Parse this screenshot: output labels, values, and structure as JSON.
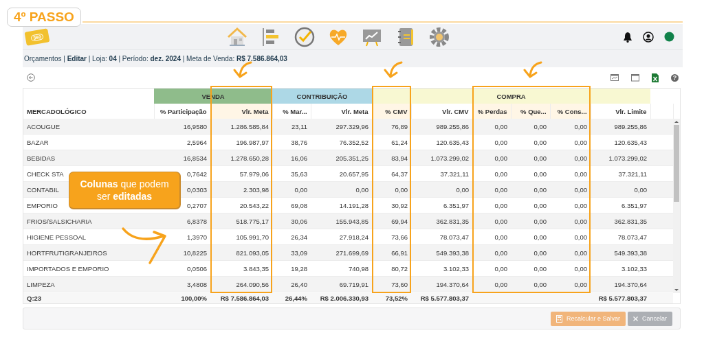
{
  "step_badge": "4º PASSO",
  "header": {
    "logo_text": "360"
  },
  "breadcrumb": "Orçamentos | **Editar** | Loja: **04** | Período: **dez. 2024** | Meta de Venda: **R$ 7.586.864,03**",
  "toolbar": {
    "help_glyph": "?"
  },
  "table": {
    "groups": [
      {
        "label": "MERCADOLÓGICO",
        "kind": "plain"
      },
      {
        "label": "VENDA",
        "kind": "band",
        "color": "#8fbc8b",
        "columns": [
          {
            "label": "% Participação",
            "highlighted": false
          },
          {
            "label": "Vlr. Meta",
            "highlighted": true
          }
        ]
      },
      {
        "label": "CONTRIBUIÇÃO",
        "kind": "band",
        "color": "#add8e6",
        "columns": [
          {
            "label": "% Mar...",
            "highlighted": false
          },
          {
            "label": "Vlr. Meta",
            "highlighted": false
          }
        ]
      },
      {
        "label": "COMPRA",
        "kind": "band",
        "color": "#f8f8d2",
        "columns": [
          {
            "label": "% CMV",
            "highlighted": true
          },
          {
            "label": "Vlr. CMV",
            "highlighted": false
          },
          {
            "label": "% Perdas",
            "highlighted": true
          },
          {
            "label": "% Que...",
            "highlighted": true
          },
          {
            "label": "% Cons...",
            "highlighted": true
          },
          {
            "label": "Vlr. Limite",
            "highlighted": false
          }
        ]
      }
    ],
    "rows": [
      [
        "ACOUGUE",
        "16,9580",
        "1.286.585,84",
        "23,11",
        "297.329,96",
        "76,89",
        "989.255,86",
        "0,00",
        "0,00",
        "0,00",
        "989.255,86"
      ],
      [
        "BAZAR",
        "2,5964",
        "196.987,97",
        "38,76",
        "76.352,52",
        "61,24",
        "120.635,43",
        "0,00",
        "0,00",
        "0,00",
        "120.635,43"
      ],
      [
        "BEBIDAS",
        "16,8534",
        "1.278.650,28",
        "16,06",
        "205.351,25",
        "83,94",
        "1.073.299,02",
        "0,00",
        "0,00",
        "0,00",
        "1.073.299,02"
      ],
      [
        "CHECK STA",
        "0,7642",
        "57.979,06",
        "35,63",
        "20.657,95",
        "64,37",
        "37.321,11",
        "0,00",
        "0,00",
        "0,00",
        "37.321,11"
      ],
      [
        "CONTABIL",
        "0,0303",
        "2.303,98",
        "0,00",
        "0,00",
        "0,00",
        "0,00",
        "0,00",
        "0,00",
        "0,00",
        "0,00"
      ],
      [
        "EMPORIO",
        "0,2707",
        "20.543,22",
        "69,08",
        "14.191,28",
        "30,92",
        "6.351,97",
        "0,00",
        "0,00",
        "0,00",
        "6.351,97"
      ],
      [
        "FRIOS/SALSICHARIA",
        "6,8378",
        "518.775,17",
        "30,06",
        "155.943,85",
        "69,94",
        "362.831,35",
        "0,00",
        "0,00",
        "0,00",
        "362.831,35"
      ],
      [
        "HIGIENE PESSOAL",
        "1,3970",
        "105.991,70",
        "26,34",
        "27.918,24",
        "73,66",
        "78.073,47",
        "0,00",
        "0,00",
        "0,00",
        "78.073,47"
      ],
      [
        "HORTFRUTIGRANJEIROS",
        "10,8225",
        "821.093,05",
        "33,09",
        "271.699,69",
        "66,91",
        "549.393,38",
        "0,00",
        "0,00",
        "0,00",
        "549.393,38"
      ],
      [
        "IMPORTADOS E EMPORIO",
        "0,0506",
        "3.843,35",
        "19,28",
        "740,98",
        "80,72",
        "3.102,33",
        "0,00",
        "0,00",
        "0,00",
        "3.102,33"
      ],
      [
        "LIMPEZA",
        "3,4808",
        "264.090,56",
        "26,40",
        "69.719,91",
        "73,60",
        "194.370,64",
        "0,00",
        "0,00",
        "0,00",
        "194.370,64"
      ]
    ],
    "footer": [
      {
        "kind": "text",
        "text": "Q:23"
      },
      {
        "kind": "text",
        "text": "100,00%"
      },
      {
        "kind": "text",
        "text": "R$ 7.586.864,03"
      },
      {
        "kind": "text",
        "text": "26,44%"
      },
      {
        "kind": "text",
        "text": "R$ 2.006.330,93"
      },
      {
        "kind": "text",
        "text": "73,52%"
      },
      {
        "kind": "text",
        "text": "R$ 5.577.803,37"
      },
      {
        "kind": "empty"
      },
      {
        "kind": "empty"
      },
      {
        "kind": "empty"
      },
      {
        "kind": "text",
        "text": "R$ 5.577.803,37"
      }
    ]
  },
  "buttons": [
    {
      "label": "Recalcular e Salvar",
      "kind": "primary",
      "disabled": true
    },
    {
      "label": "Cancelar",
      "kind": "secondary",
      "disabled": true
    }
  ],
  "callout": "**Colunas** que podem ser **editadas**"
}
